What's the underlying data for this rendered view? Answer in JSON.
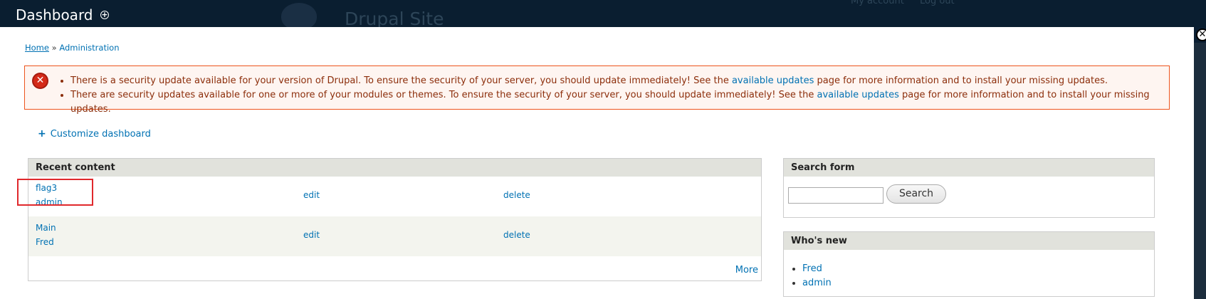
{
  "background_site": {
    "site_name": "Drupal Site",
    "user_links": [
      "My account",
      "Log out"
    ]
  },
  "overlay": {
    "title": "Dashboard",
    "shortcut_symbol": "+",
    "close_symbol": "✕"
  },
  "breadcrumb": {
    "home": "Home",
    "separator": " » ",
    "current": "Administration"
  },
  "messages": {
    "type": "error",
    "icon_symbol": "✕",
    "items": [
      {
        "before": "There is a security update available for your version of Drupal. To ensure the security of your server, you should update immediately! See the ",
        "link": "available updates",
        "after": " page for more information and to install your missing updates."
      },
      {
        "before": "There are security updates available for one or more of your modules or themes. To ensure the security of your server, you should update immediately! See the ",
        "link": "available updates",
        "after": " page for more information and to install your missing updates."
      }
    ]
  },
  "customize": {
    "icon": "+",
    "label": "Customize dashboard"
  },
  "recent_content": {
    "title": "Recent content",
    "rows": [
      {
        "title": "flag3",
        "author": "admin",
        "edit": "edit",
        "delete": "delete"
      },
      {
        "title": "Main",
        "author": "Fred",
        "edit": "edit",
        "delete": "delete"
      }
    ],
    "more": "More"
  },
  "search_form": {
    "title": "Search form",
    "input_value": "",
    "button": "Search"
  },
  "whos_new": {
    "title": "Who's new",
    "users": [
      "Fred",
      "admin"
    ]
  },
  "colors": {
    "link": "#0071b3",
    "error_border": "#ed541d",
    "error_bg": "#fef5f1",
    "error_text": "#8c2e0b",
    "highlight": "#e0282c",
    "toolbar_bg": "#0a1e30"
  }
}
